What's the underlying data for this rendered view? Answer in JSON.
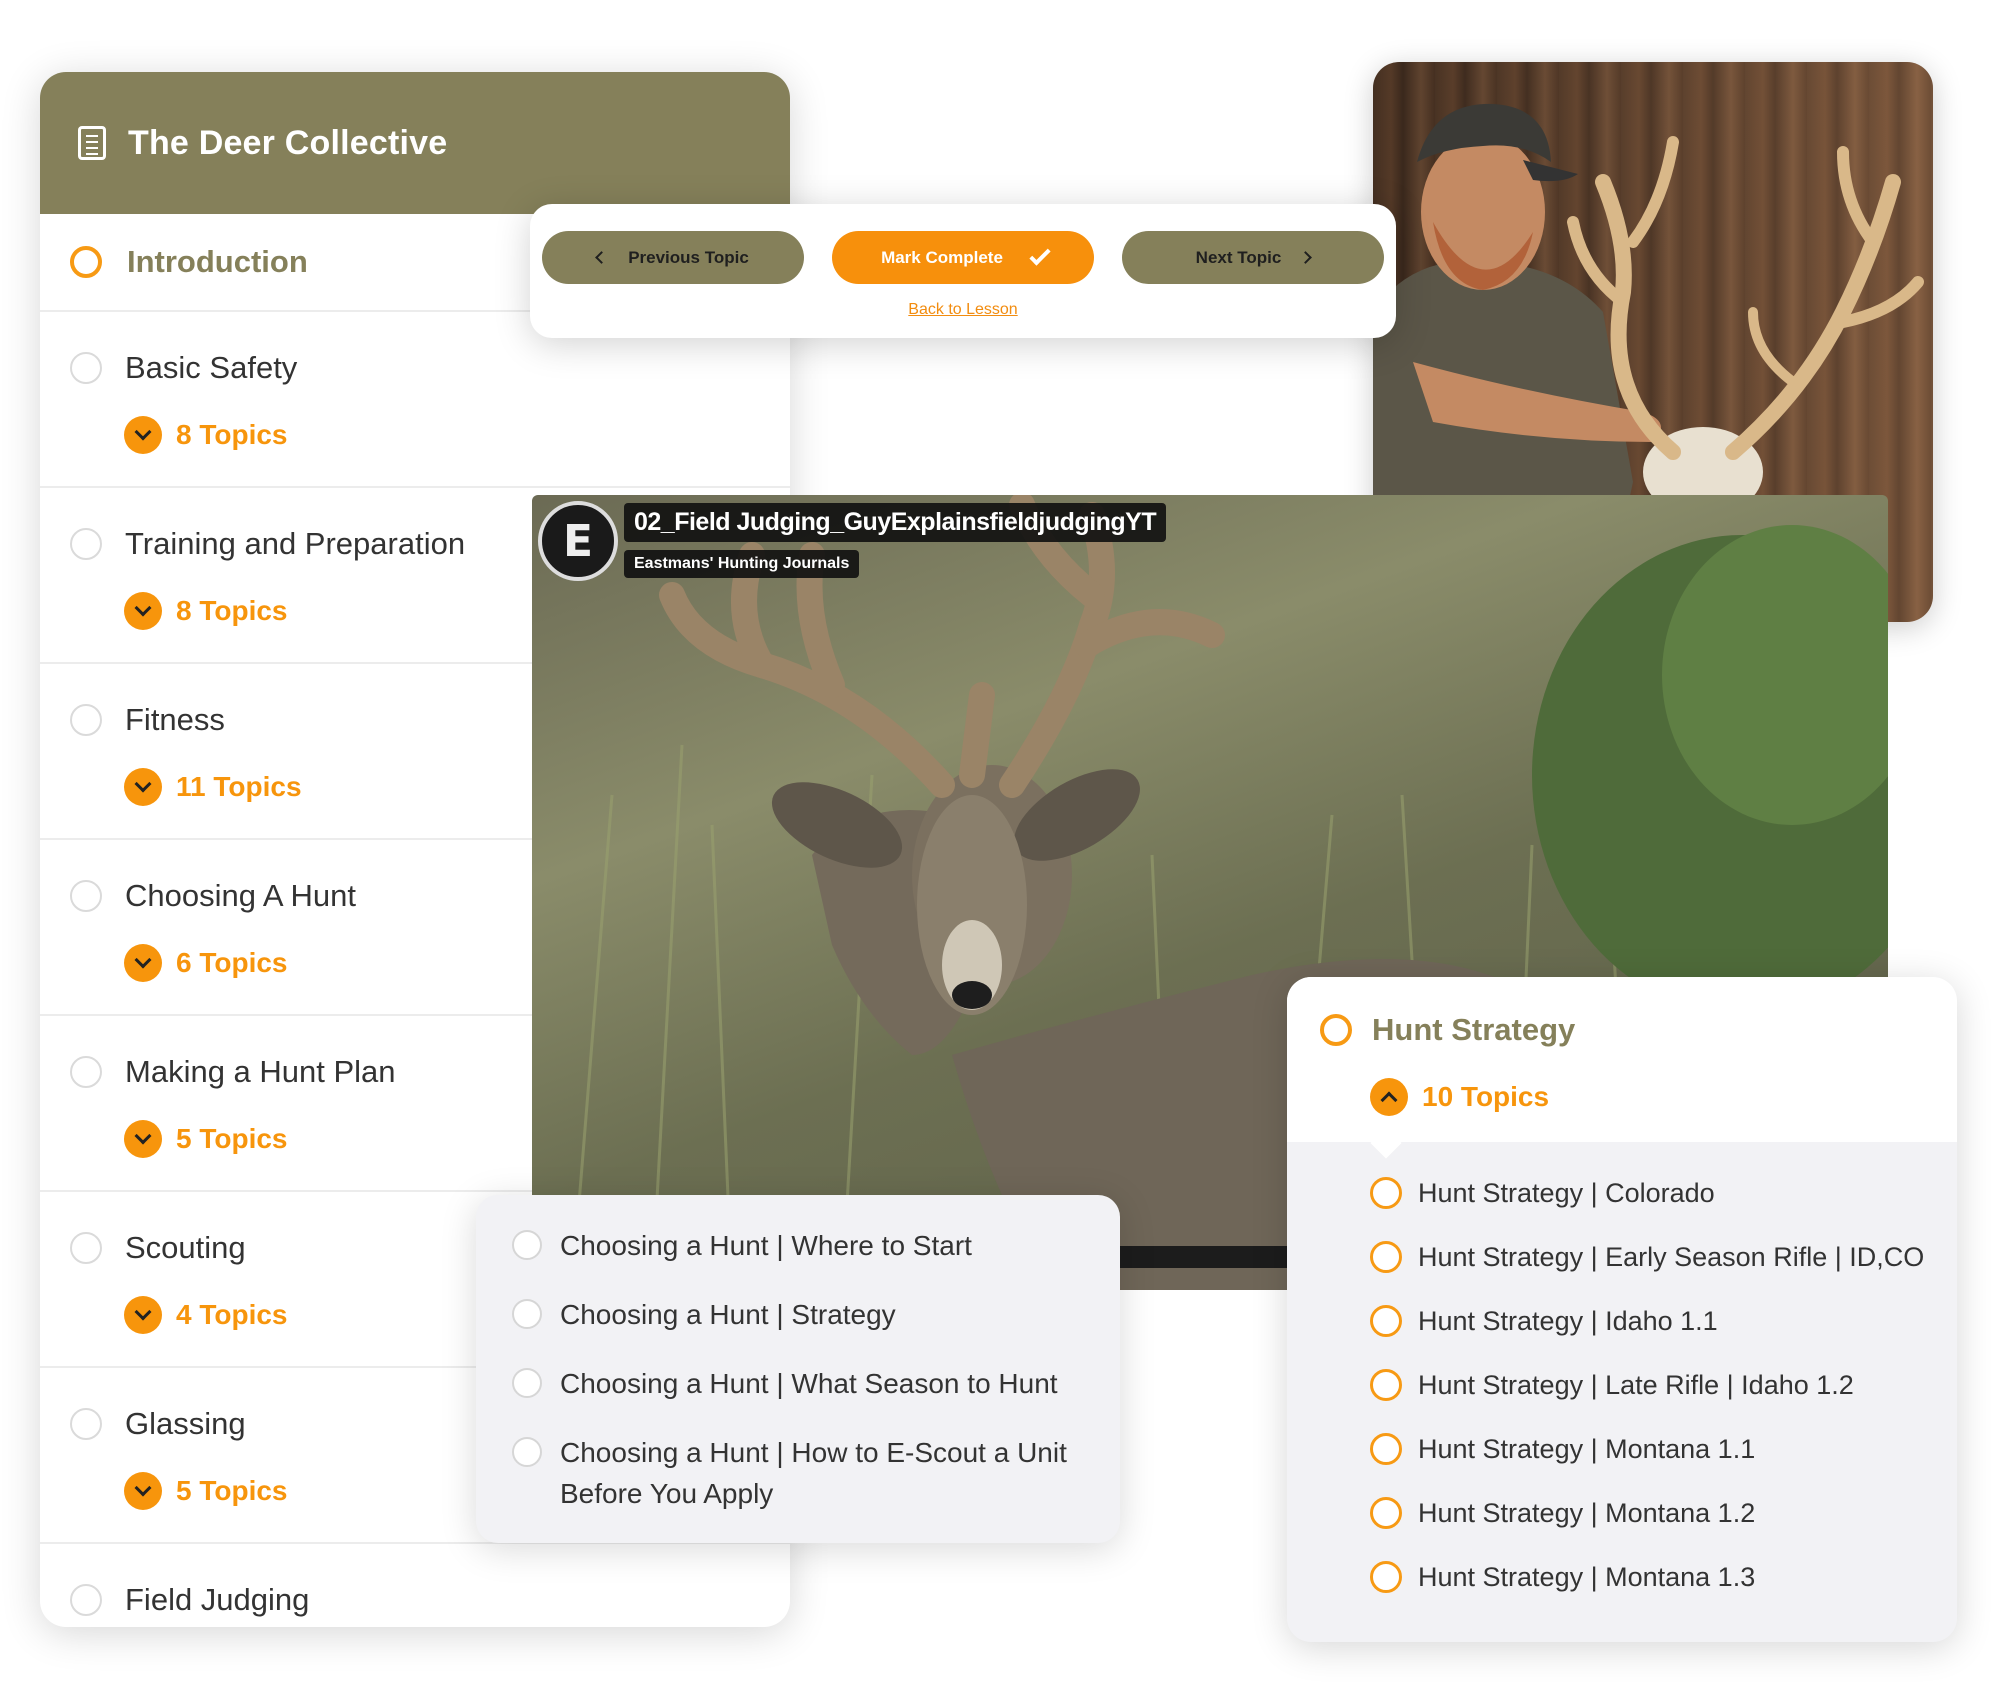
{
  "course": {
    "title": "The Deer Collective",
    "icon": "document-icon",
    "intro_label": "Introduction",
    "lessons": [
      {
        "title": "Basic Safety",
        "topics": "8 Topics"
      },
      {
        "title": "Training and Preparation",
        "topics": "8 Topics"
      },
      {
        "title": "Fitness",
        "topics": "11 Topics"
      },
      {
        "title": "Choosing A Hunt",
        "topics": "6 Topics"
      },
      {
        "title": "Making a Hunt Plan",
        "topics": "5 Topics"
      },
      {
        "title": "Scouting",
        "topics": "4 Topics"
      },
      {
        "title": "Glassing",
        "topics": "5 Topics"
      }
    ],
    "last_lesson": "Field Judging"
  },
  "nav": {
    "previous": "Previous Topic",
    "mark": "Mark Complete",
    "next": "Next Topic",
    "back": "Back to Lesson"
  },
  "video": {
    "title": "02_Field Judging_GuyExplainsfieldjudgingYT",
    "channel": "Eastmans' Hunting Journals",
    "avatar_letter": "E"
  },
  "choosing_topics": [
    "Choosing a Hunt | Where to Start",
    "Choosing a Hunt | Strategy",
    "Choosing a Hunt | What Season to Hunt",
    "Choosing a Hunt | How to E-Scout a Unit Before You Apply"
  ],
  "strategy": {
    "title": "Hunt Strategy",
    "topics": "10 Topics",
    "items": [
      "Hunt Strategy | Colorado",
      "Hunt Strategy | Early Season Rifle | ID,CO",
      "Hunt Strategy | Idaho 1.1",
      "Hunt Strategy | Late Rifle | Idaho 1.2",
      "Hunt Strategy | Montana 1.1",
      "Hunt Strategy | Montana 1.2",
      "Hunt Strategy | Montana 1.3"
    ]
  },
  "colors": {
    "olive": "#85805a",
    "orange": "#f7950c"
  }
}
